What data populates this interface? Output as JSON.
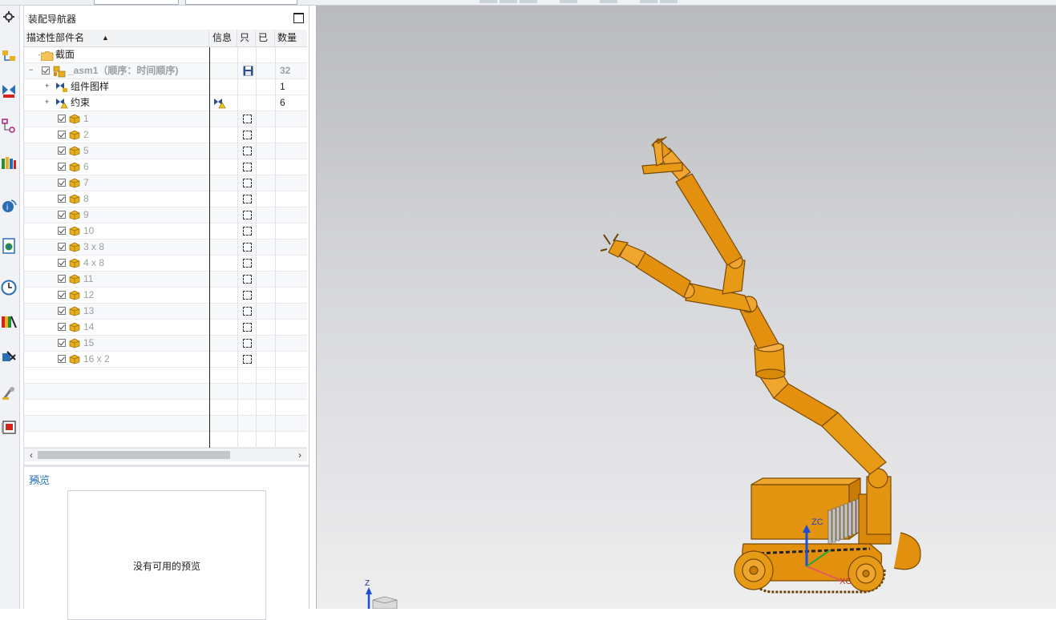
{
  "navigator": {
    "title": "装配导航器",
    "columns": {
      "name": "描述性部件名",
      "info": "信息",
      "readonly": "只",
      "modified": "已",
      "count": "数量"
    },
    "rows": [
      {
        "label": "截面",
        "type": "folder",
        "count": "",
        "gray": false
      },
      {
        "label": "_asm1（顺序：时间顺序)",
        "type": "assembly",
        "count": "32",
        "gray": true
      },
      {
        "label": "组件图样",
        "type": "drawing",
        "count": "1",
        "gray": false
      },
      {
        "label": "约束",
        "type": "constraint",
        "count": "6",
        "gray": false
      },
      {
        "label": "1",
        "type": "part",
        "count": "",
        "gray": true
      },
      {
        "label": "2",
        "type": "part",
        "count": "",
        "gray": true
      },
      {
        "label": "5",
        "type": "part",
        "count": "",
        "gray": true
      },
      {
        "label": "6",
        "type": "part",
        "count": "",
        "gray": true
      },
      {
        "label": "7",
        "type": "part",
        "count": "",
        "gray": true
      },
      {
        "label": "8",
        "type": "part",
        "count": "",
        "gray": true
      },
      {
        "label": "9",
        "type": "part",
        "count": "",
        "gray": true
      },
      {
        "label": "10",
        "type": "part",
        "count": "",
        "gray": true
      },
      {
        "label": "3 x 8",
        "type": "part",
        "count": "",
        "gray": true
      },
      {
        "label": "4 x 8",
        "type": "part",
        "count": "",
        "gray": true
      },
      {
        "label": "11",
        "type": "part",
        "count": "",
        "gray": true
      },
      {
        "label": "12",
        "type": "part",
        "count": "",
        "gray": true
      },
      {
        "label": "13",
        "type": "part",
        "count": "",
        "gray": true
      },
      {
        "label": "14",
        "type": "part",
        "count": "",
        "gray": true
      },
      {
        "label": "15",
        "type": "part",
        "count": "",
        "gray": true
      },
      {
        "label": "16 x 2",
        "type": "part",
        "count": "",
        "gray": true
      }
    ]
  },
  "preview": {
    "title": "预览",
    "empty_text": "没有可用的预览"
  },
  "viewport": {
    "axis_zc": "ZC",
    "axis_xc": "XC",
    "axis_z": "Z"
  },
  "toolbar_icons": [
    "gear-icon",
    "assembly-navigator-icon",
    "constraint-navigator-icon",
    "part-navigator-icon",
    "reuse-library-icon",
    "hd3d-tools-icon",
    "web-browser-icon",
    "history-icon",
    "system-materials-icon",
    "process-studio-icon",
    "manufacturing-wizard-icon",
    "roles-icon"
  ],
  "colors": {
    "accent": "#2f78b4",
    "model": "#e3900e",
    "model_dark": "#8a5406"
  }
}
